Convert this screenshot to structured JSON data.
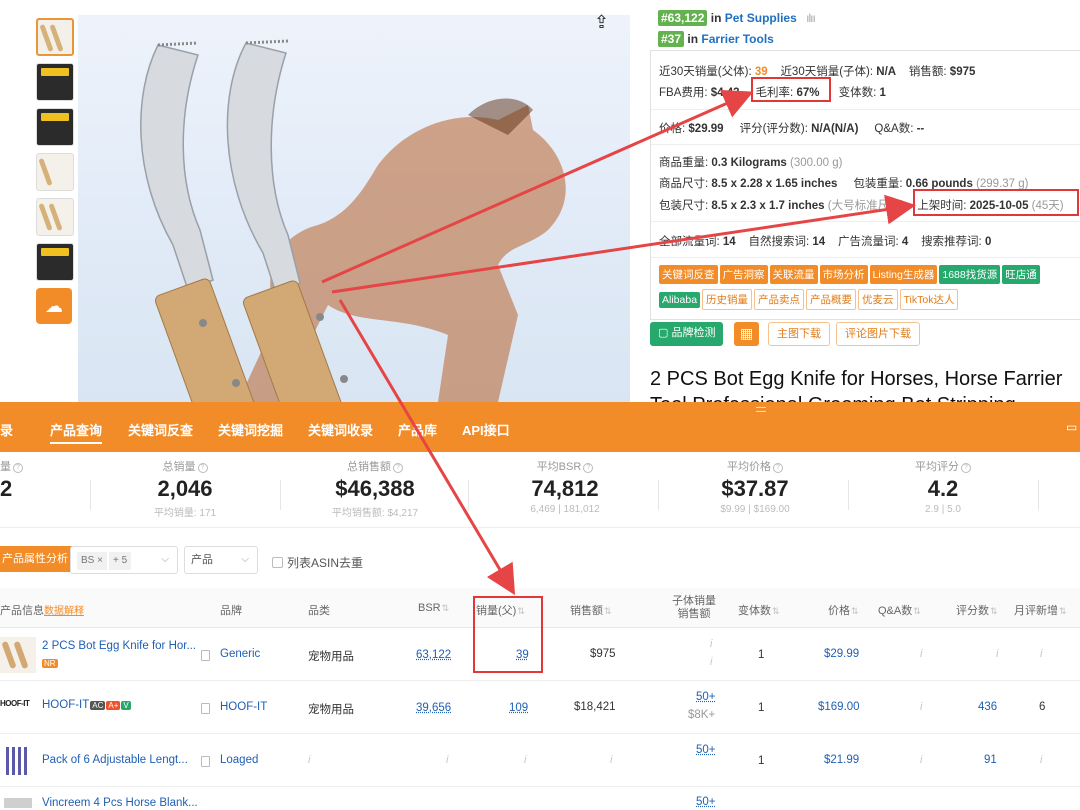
{
  "product": {
    "rank1": {
      "num": "#63,122",
      "in": "in",
      "cat": "Pet Supplies"
    },
    "rank2": {
      "num": "#37",
      "in": "in",
      "cat": "Farrier Tools"
    },
    "sales30_parent_label": "近30天销量(父体):",
    "sales30_parent": "39",
    "sales30_child_label": "近30天销量(子体):",
    "sales30_child": "N/A",
    "revenue_label": "销售额:",
    "revenue": "$975",
    "fba_label": "FBA费用:",
    "fba": "$4.43",
    "margin_label": "毛利率:",
    "margin": "67%",
    "variants_label": "变体数:",
    "variants": "1",
    "price_label": "价格:",
    "price": "$29.99",
    "rating_label": "评分(评分数):",
    "rating": "N/A(N/A)",
    "qa_label": "Q&A数:",
    "qa": "--",
    "weight_label": "商品重量:",
    "weight": "0.3 Kilograms",
    "weight_g": "(300.00 g)",
    "dims_label": "商品尺寸:",
    "dims": "8.5 x 2.28 x 1.65 inches",
    "pkg_weight_label": "包装重量:",
    "pkg_weight": "0.66 pounds",
    "pkg_weight_g": "(299.37 g)",
    "pkg_dims_label": "包装尺寸:",
    "pkg_dims": "8.5 x 2.3 x 1.7 inches",
    "pkg_dims_note": "(大号标准尺寸)",
    "listed_label": "上架时间:",
    "listed": "2025-10-05",
    "listed_days": "(45天)",
    "traffic_all_label": "全部流量词:",
    "traffic_all": "14",
    "traffic_natural_label": "自然搜索词:",
    "traffic_natural": "14",
    "traffic_ads_label": "广告流量词:",
    "traffic_ads": "4",
    "traffic_rec_label": "搜索推荐词:",
    "traffic_rec": "0",
    "tags_row1": [
      "关键词反查",
      "广告洞察",
      "关联流量",
      "市场分析",
      "Listing生成器"
    ],
    "tags_row1_green": [
      "1688找货源",
      "旺店通"
    ],
    "tags_row2_green": [
      "Alibaba"
    ],
    "tags_row2": [
      "历史销量",
      "产品卖点",
      "产品概要",
      "优麦云",
      "TikTok达人"
    ],
    "btn_brand": "▢ 品牌检测",
    "btn_calc": "▦",
    "btn_main_dl": "主图下载",
    "btn_review_dl": "评论图片下载",
    "title": "2 PCS Bot Egg Knife for Horses, Horse Farrier",
    "title_line2": "Tool Professional Grooming Bot Stripping"
  },
  "nav": {
    "left_cut": "录",
    "items": [
      "产品查询",
      "关键词反查",
      "关键词挖掘",
      "关键词收录",
      "产品库",
      "API接口"
    ],
    "edge": "▭"
  },
  "stats": [
    {
      "label": "量",
      "value": "2",
      "sub": ""
    },
    {
      "label": "总销量",
      "value": "2,046",
      "sub": "平均销量: 171"
    },
    {
      "label": "总销售额",
      "value": "$46,388",
      "sub": "平均销售额: $4,217"
    },
    {
      "label": "平均BSR",
      "value": "74,812",
      "sub": "6,469 | 181,012"
    },
    {
      "label": "平均价格",
      "value": "$37.87",
      "sub": "$9.99 | $169.00"
    },
    {
      "label": "平均评分",
      "value": "4.2",
      "sub": "2.9 | 5.0"
    }
  ],
  "filters": {
    "attr_btn": "产品属性分析",
    "chip_bs": "BS ×",
    "chip_more": "+ 5",
    "select2": "产品",
    "checkbox": "列表ASIN去重"
  },
  "table": {
    "headers": {
      "info": "产品信息",
      "info_link": "数据解释",
      "brand": "品牌",
      "category": "品类",
      "bsr": "BSR",
      "sales_parent": "销量(父)",
      "revenue": "销售额",
      "child_line1": "子体销量",
      "child_line2": "销售额",
      "variants": "变体数",
      "price": "价格",
      "qa": "Q&A数",
      "rating_count": "评分数",
      "monthly_new": "月评新增"
    },
    "rows": [
      {
        "title": "2 PCS Bot Egg Knife for Hor...",
        "badge": "NR",
        "brand": "Generic",
        "category": "宠物用品",
        "bsr": "63,122",
        "sales": "39",
        "revenue": "$975",
        "child1": "i",
        "child2": "i",
        "variants": "1",
        "price": "$29.99",
        "qa": "i",
        "rating_count": "i",
        "monthly": "i"
      },
      {
        "title": "HOOF-IT",
        "logo": "HOOF-IT",
        "badges": [
          "AC",
          "A+",
          "V"
        ],
        "brand": "HOOF-IT",
        "category": "宠物用品",
        "bsr": "39,656",
        "sales": "109",
        "revenue": "$18,421",
        "child1": "50+",
        "child2": "$8K+",
        "variants": "1",
        "price": "$169.00",
        "qa": "i",
        "rating_count": "436",
        "monthly": "6"
      },
      {
        "title": "Pack of 6 Adjustable Lengt...",
        "brand": "Loaged",
        "category": "i",
        "bsr": "i",
        "sales": "i",
        "revenue": "i",
        "child1": "50+",
        "child2": "",
        "variants": "1",
        "price": "$21.99",
        "qa": "i",
        "rating_count": "91",
        "monthly": "i"
      },
      {
        "title": "Vincreem 4 Pcs Horse Blank...",
        "child1": "50+"
      }
    ]
  },
  "colors": {
    "accent": "#f28c28",
    "highlight": "#e0373a",
    "link": "#1f5fb4",
    "green": "#27a86c"
  }
}
